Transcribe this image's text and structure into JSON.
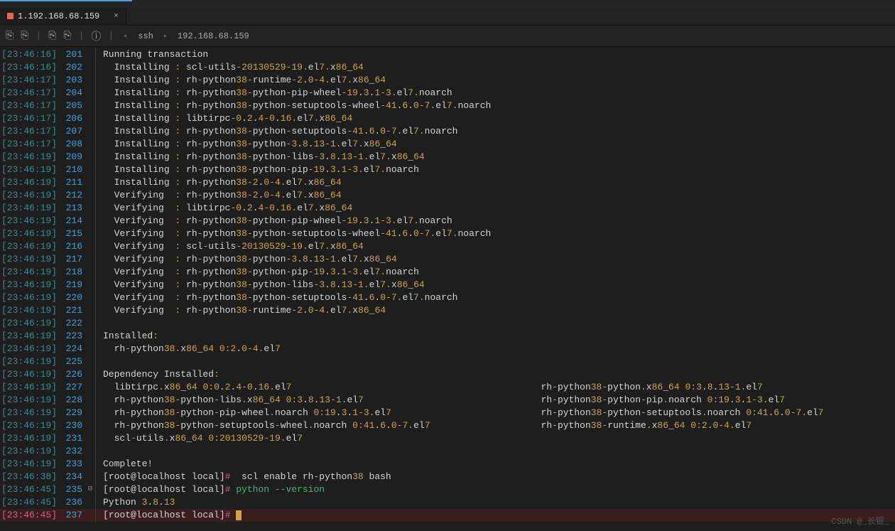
{
  "tab": {
    "title": "1.192.168.68.159",
    "close": "×"
  },
  "toolbar": {
    "icons": [
      "⎘",
      "⎘",
      "⎘",
      "⎘",
      "ⓘ"
    ],
    "crumb_sep": "▸",
    "crumbs": [
      "ssh",
      "192.168.68.159"
    ]
  },
  "watermark": "CSDN @_长银_",
  "lines": [
    {
      "ts": "23:46:16",
      "ln": "201",
      "txt": "Running transaction"
    },
    {
      "ts": "23:46:16",
      "ln": "202",
      "txt": "  Installing : scl-utils-20130529-19.el7.x86_64"
    },
    {
      "ts": "23:46:17",
      "ln": "203",
      "txt": "  Installing : rh-python38-runtime-2.0-4.el7.x86_64"
    },
    {
      "ts": "23:46:17",
      "ln": "204",
      "txt": "  Installing : rh-python38-python-pip-wheel-19.3.1-3.el7.noarch"
    },
    {
      "ts": "23:46:17",
      "ln": "205",
      "txt": "  Installing : rh-python38-python-setuptools-wheel-41.6.0-7.el7.noarch"
    },
    {
      "ts": "23:46:17",
      "ln": "206",
      "txt": "  Installing : libtirpc-0.2.4-0.16.el7.x86_64"
    },
    {
      "ts": "23:46:17",
      "ln": "207",
      "txt": "  Installing : rh-python38-python-setuptools-41.6.0-7.el7.noarch"
    },
    {
      "ts": "23:46:17",
      "ln": "208",
      "txt": "  Installing : rh-python38-python-3.8.13-1.el7.x86_64"
    },
    {
      "ts": "23:46:19",
      "ln": "209",
      "txt": "  Installing : rh-python38-python-libs-3.8.13-1.el7.x86_64"
    },
    {
      "ts": "23:46:19",
      "ln": "210",
      "txt": "  Installing : rh-python38-python-pip-19.3.1-3.el7.noarch"
    },
    {
      "ts": "23:46:19",
      "ln": "211",
      "txt": "  Installing : rh-python38-2.0-4.el7.x86_64"
    },
    {
      "ts": "23:46:19",
      "ln": "212",
      "txt": "  Verifying  : rh-python38-2.0-4.el7.x86_64"
    },
    {
      "ts": "23:46:19",
      "ln": "213",
      "txt": "  Verifying  : libtirpc-0.2.4-0.16.el7.x86_64"
    },
    {
      "ts": "23:46:19",
      "ln": "214",
      "txt": "  Verifying  : rh-python38-python-pip-wheel-19.3.1-3.el7.noarch"
    },
    {
      "ts": "23:46:19",
      "ln": "215",
      "txt": "  Verifying  : rh-python38-python-setuptools-wheel-41.6.0-7.el7.noarch"
    },
    {
      "ts": "23:46:19",
      "ln": "216",
      "txt": "  Verifying  : scl-utils-20130529-19.el7.x86_64"
    },
    {
      "ts": "23:46:19",
      "ln": "217",
      "txt": "  Verifying  : rh-python38-python-3.8.13-1.el7.x86_64"
    },
    {
      "ts": "23:46:19",
      "ln": "218",
      "txt": "  Verifying  : rh-python38-python-pip-19.3.1-3.el7.noarch"
    },
    {
      "ts": "23:46:19",
      "ln": "219",
      "txt": "  Verifying  : rh-python38-python-libs-3.8.13-1.el7.x86_64"
    },
    {
      "ts": "23:46:19",
      "ln": "220",
      "txt": "  Verifying  : rh-python38-python-setuptools-41.6.0-7.el7.noarch"
    },
    {
      "ts": "23:46:19",
      "ln": "221",
      "txt": "  Verifying  : rh-python38-runtime-2.0-4.el7.x86_64"
    },
    {
      "ts": "23:46:19",
      "ln": "222",
      "txt": ""
    },
    {
      "ts": "23:46:19",
      "ln": "223",
      "txt": "Installed:"
    },
    {
      "ts": "23:46:19",
      "ln": "224",
      "txt": "  rh-python38.x86_64 0:2.0-4.el7"
    },
    {
      "ts": "23:46:19",
      "ln": "225",
      "txt": ""
    },
    {
      "ts": "23:46:19",
      "ln": "226",
      "txt": "Dependency Installed:"
    },
    {
      "ts": "23:46:19",
      "ln": "227",
      "txt": "  libtirpc.x86_64 0:0.2.4-0.16.el7                                             rh-python38-python.x86_64 0:3.8.13-1.el7"
    },
    {
      "ts": "23:46:19",
      "ln": "228",
      "txt": "  rh-python38-python-libs.x86_64 0:3.8.13-1.el7                                rh-python38-python-pip.noarch 0:19.3.1-3.el7"
    },
    {
      "ts": "23:46:19",
      "ln": "229",
      "txt": "  rh-python38-python-pip-wheel.noarch 0:19.3.1-3.el7                           rh-python38-python-setuptools.noarch 0:41.6.0-7.el7"
    },
    {
      "ts": "23:46:19",
      "ln": "230",
      "txt": "  rh-python38-python-setuptools-wheel.noarch 0:41.6.0-7.el7                    rh-python38-runtime.x86_64 0:2.0-4.el7"
    },
    {
      "ts": "23:46:19",
      "ln": "231",
      "txt": "  scl-utils.x86_64 0:20130529-19.el7"
    },
    {
      "ts": "23:46:19",
      "ln": "232",
      "txt": ""
    },
    {
      "ts": "23:46:19",
      "ln": "233",
      "txt": "Complete!"
    },
    {
      "ts": "23:46:38",
      "ln": "234",
      "type": "prompt",
      "prompt": "[root@localhost local]#",
      "cmd_white": "  scl enable rh-python38 bash"
    },
    {
      "ts": "23:46:45",
      "ln": "235",
      "type": "prompt",
      "prompt": "[root@localhost local]#",
      "cmd_green": " python --version",
      "icon": "⊟"
    },
    {
      "ts": "23:46:45",
      "ln": "236",
      "txt": "Python 3.8.13"
    },
    {
      "ts": "23:46:45",
      "ln": "237",
      "type": "prompt",
      "prompt": "[root@localhost local]#",
      "active": true,
      "cursor": true
    }
  ]
}
